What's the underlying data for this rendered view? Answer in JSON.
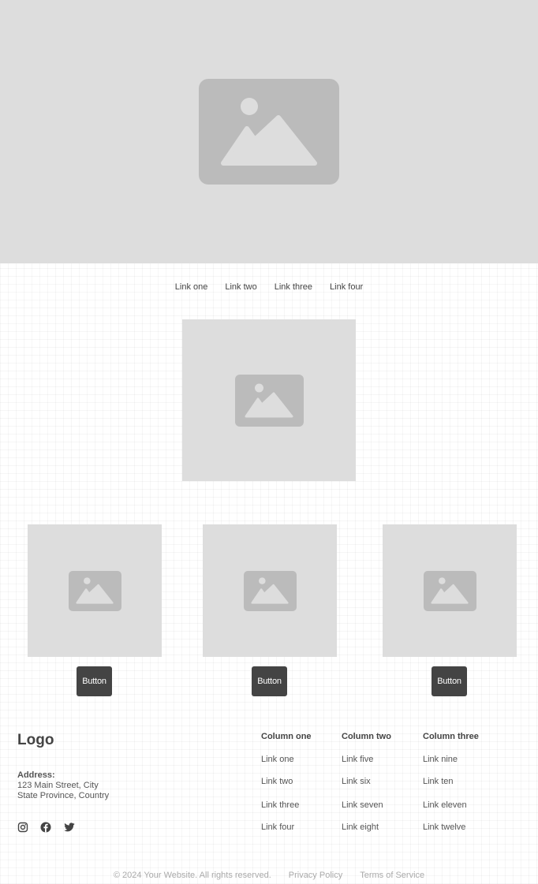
{
  "hero": {
    "icon": "image-placeholder-icon"
  },
  "nav": {
    "links": [
      "Link one",
      "Link two",
      "Link three",
      "Link four"
    ]
  },
  "featured": {
    "icon": "image-placeholder-icon"
  },
  "cards": [
    {
      "icon": "image-placeholder-icon",
      "button_label": "Button"
    },
    {
      "icon": "image-placeholder-icon",
      "button_label": "Button"
    },
    {
      "icon": "image-placeholder-icon",
      "button_label": "Button"
    }
  ],
  "footer": {
    "logo": "Logo",
    "address_label": "Address:",
    "address_lines": [
      "123 Main Street, City",
      "State Province, Country"
    ],
    "social_icons": [
      "instagram-icon",
      "facebook-icon",
      "twitter-icon"
    ],
    "columns": [
      {
        "heading": "Column one",
        "links": [
          "Link one",
          "Link two",
          "Link three",
          "Link four"
        ]
      },
      {
        "heading": "Column two",
        "links": [
          "Link five",
          "Link six",
          "Link seven",
          "Link eight"
        ]
      },
      {
        "heading": "Column three",
        "links": [
          "Link nine",
          "Link ten",
          "Link eleven",
          "Link twelve"
        ]
      }
    ],
    "copyright": "© 2024 Your Website. All rights reserved.",
    "legal_links": [
      "Privacy Policy",
      "Terms of Service"
    ]
  },
  "colors": {
    "placeholder_bg": "#dddddd",
    "placeholder_icon": "#bbbbbb",
    "button_bg": "#444444",
    "text": "#444444",
    "muted_text": "#aaaaaa"
  }
}
